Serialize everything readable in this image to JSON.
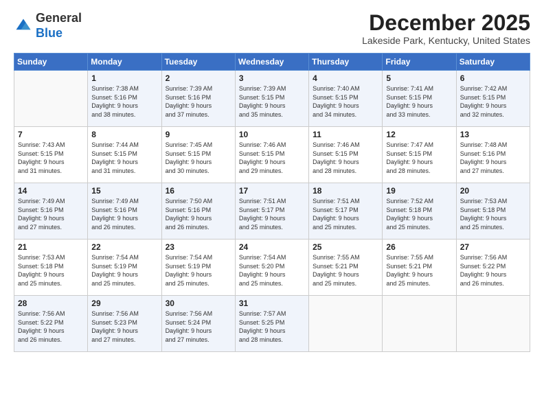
{
  "logo": {
    "general": "General",
    "blue": "Blue"
  },
  "header": {
    "month": "December 2025",
    "location": "Lakeside Park, Kentucky, United States"
  },
  "days_of_week": [
    "Sunday",
    "Monday",
    "Tuesday",
    "Wednesday",
    "Thursday",
    "Friday",
    "Saturday"
  ],
  "weeks": [
    [
      {
        "day": "",
        "info": ""
      },
      {
        "day": "1",
        "info": "Sunrise: 7:38 AM\nSunset: 5:16 PM\nDaylight: 9 hours\nand 38 minutes."
      },
      {
        "day": "2",
        "info": "Sunrise: 7:39 AM\nSunset: 5:16 PM\nDaylight: 9 hours\nand 37 minutes."
      },
      {
        "day": "3",
        "info": "Sunrise: 7:39 AM\nSunset: 5:15 PM\nDaylight: 9 hours\nand 35 minutes."
      },
      {
        "day": "4",
        "info": "Sunrise: 7:40 AM\nSunset: 5:15 PM\nDaylight: 9 hours\nand 34 minutes."
      },
      {
        "day": "5",
        "info": "Sunrise: 7:41 AM\nSunset: 5:15 PM\nDaylight: 9 hours\nand 33 minutes."
      },
      {
        "day": "6",
        "info": "Sunrise: 7:42 AM\nSunset: 5:15 PM\nDaylight: 9 hours\nand 32 minutes."
      }
    ],
    [
      {
        "day": "7",
        "info": "Sunrise: 7:43 AM\nSunset: 5:15 PM\nDaylight: 9 hours\nand 31 minutes."
      },
      {
        "day": "8",
        "info": "Sunrise: 7:44 AM\nSunset: 5:15 PM\nDaylight: 9 hours\nand 31 minutes."
      },
      {
        "day": "9",
        "info": "Sunrise: 7:45 AM\nSunset: 5:15 PM\nDaylight: 9 hours\nand 30 minutes."
      },
      {
        "day": "10",
        "info": "Sunrise: 7:46 AM\nSunset: 5:15 PM\nDaylight: 9 hours\nand 29 minutes."
      },
      {
        "day": "11",
        "info": "Sunrise: 7:46 AM\nSunset: 5:15 PM\nDaylight: 9 hours\nand 28 minutes."
      },
      {
        "day": "12",
        "info": "Sunrise: 7:47 AM\nSunset: 5:15 PM\nDaylight: 9 hours\nand 28 minutes."
      },
      {
        "day": "13",
        "info": "Sunrise: 7:48 AM\nSunset: 5:16 PM\nDaylight: 9 hours\nand 27 minutes."
      }
    ],
    [
      {
        "day": "14",
        "info": "Sunrise: 7:49 AM\nSunset: 5:16 PM\nDaylight: 9 hours\nand 27 minutes."
      },
      {
        "day": "15",
        "info": "Sunrise: 7:49 AM\nSunset: 5:16 PM\nDaylight: 9 hours\nand 26 minutes."
      },
      {
        "day": "16",
        "info": "Sunrise: 7:50 AM\nSunset: 5:16 PM\nDaylight: 9 hours\nand 26 minutes."
      },
      {
        "day": "17",
        "info": "Sunrise: 7:51 AM\nSunset: 5:17 PM\nDaylight: 9 hours\nand 25 minutes."
      },
      {
        "day": "18",
        "info": "Sunrise: 7:51 AM\nSunset: 5:17 PM\nDaylight: 9 hours\nand 25 minutes."
      },
      {
        "day": "19",
        "info": "Sunrise: 7:52 AM\nSunset: 5:18 PM\nDaylight: 9 hours\nand 25 minutes."
      },
      {
        "day": "20",
        "info": "Sunrise: 7:53 AM\nSunset: 5:18 PM\nDaylight: 9 hours\nand 25 minutes."
      }
    ],
    [
      {
        "day": "21",
        "info": "Sunrise: 7:53 AM\nSunset: 5:18 PM\nDaylight: 9 hours\nand 25 minutes."
      },
      {
        "day": "22",
        "info": "Sunrise: 7:54 AM\nSunset: 5:19 PM\nDaylight: 9 hours\nand 25 minutes."
      },
      {
        "day": "23",
        "info": "Sunrise: 7:54 AM\nSunset: 5:19 PM\nDaylight: 9 hours\nand 25 minutes."
      },
      {
        "day": "24",
        "info": "Sunrise: 7:54 AM\nSunset: 5:20 PM\nDaylight: 9 hours\nand 25 minutes."
      },
      {
        "day": "25",
        "info": "Sunrise: 7:55 AM\nSunset: 5:21 PM\nDaylight: 9 hours\nand 25 minutes."
      },
      {
        "day": "26",
        "info": "Sunrise: 7:55 AM\nSunset: 5:21 PM\nDaylight: 9 hours\nand 25 minutes."
      },
      {
        "day": "27",
        "info": "Sunrise: 7:56 AM\nSunset: 5:22 PM\nDaylight: 9 hours\nand 26 minutes."
      }
    ],
    [
      {
        "day": "28",
        "info": "Sunrise: 7:56 AM\nSunset: 5:22 PM\nDaylight: 9 hours\nand 26 minutes."
      },
      {
        "day": "29",
        "info": "Sunrise: 7:56 AM\nSunset: 5:23 PM\nDaylight: 9 hours\nand 27 minutes."
      },
      {
        "day": "30",
        "info": "Sunrise: 7:56 AM\nSunset: 5:24 PM\nDaylight: 9 hours\nand 27 minutes."
      },
      {
        "day": "31",
        "info": "Sunrise: 7:57 AM\nSunset: 5:25 PM\nDaylight: 9 hours\nand 28 minutes."
      },
      {
        "day": "",
        "info": ""
      },
      {
        "day": "",
        "info": ""
      },
      {
        "day": "",
        "info": ""
      }
    ]
  ]
}
